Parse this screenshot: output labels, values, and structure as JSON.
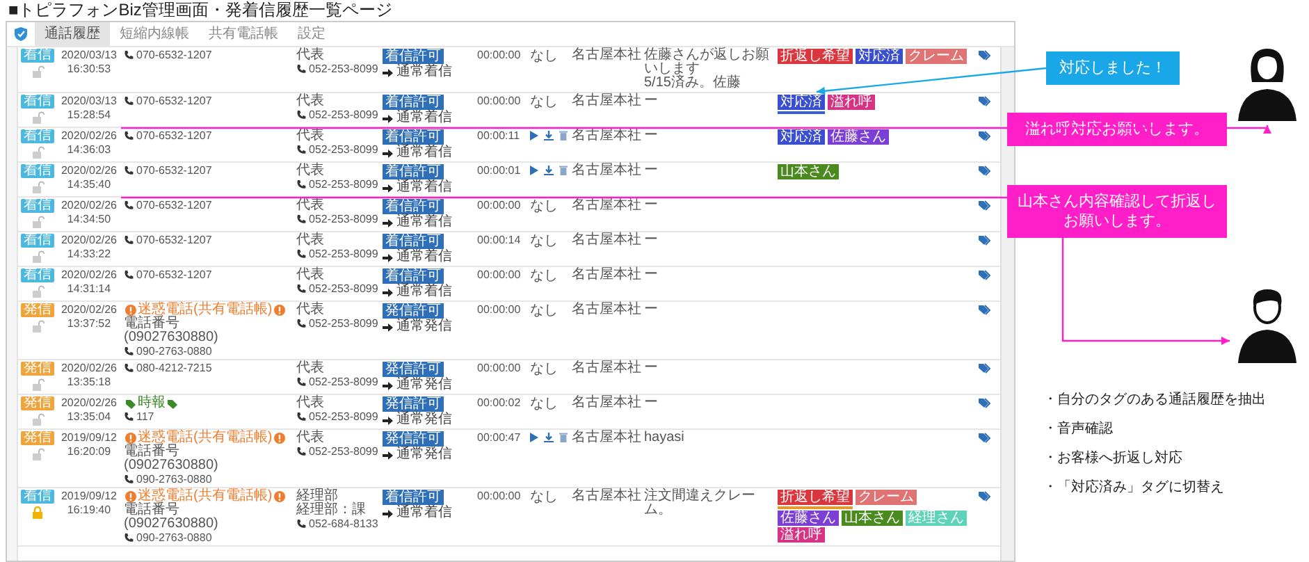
{
  "title": "■トピラフォンBiz管理画面・発着信履歴一覧ページ",
  "tabs": [
    {
      "label": "通話履歴",
      "selected": true
    },
    {
      "label": "短縮内線帳",
      "selected": false
    },
    {
      "label": "共有電話帳",
      "selected": false
    },
    {
      "label": "設定",
      "selected": false
    }
  ],
  "rows": [
    {
      "kind": "incoming",
      "badge": "着信",
      "locked": false,
      "date": "2020/03/13",
      "time": "16:30:53",
      "caller": [
        {
          "kind": "phone",
          "text": "070-6532-1207"
        }
      ],
      "callee": [
        {
          "kind": "label",
          "text": "代表"
        },
        {
          "kind": "phone",
          "text": "052-253-8099"
        }
      ],
      "permission": "着信許可",
      "route": "通常着信",
      "duration": "00:00:00",
      "recording": false,
      "action_text": "なし",
      "branch": "名古屋本社",
      "memo": [
        "佐藤さんが返しお願いします",
        "5/15済み。佐藤"
      ],
      "tags": [
        {
          "label": "折返し希望",
          "color": "#d9363e"
        },
        {
          "label": "対応済",
          "color": "#3a4fd0"
        },
        {
          "label": "クレーム",
          "color": "#e07474"
        }
      ]
    },
    {
      "kind": "incoming",
      "badge": "着信",
      "locked": false,
      "date": "2020/03/13",
      "time": "15:28:54",
      "caller": [
        {
          "kind": "phone",
          "text": "070-6532-1207"
        }
      ],
      "callee": [
        {
          "kind": "label",
          "text": "代表"
        },
        {
          "kind": "phone",
          "text": "052-253-8099"
        }
      ],
      "permission": "着信許可",
      "route": "通常着信",
      "duration": "00:00:00",
      "recording": false,
      "action_text": "なし",
      "branch": "名古屋本社",
      "memo": [
        "ー"
      ],
      "tags": [
        {
          "label": "対応済",
          "color": "#3a4fd0",
          "marker": {
            "color": "#3a5fc8"
          }
        },
        {
          "label": "溢れ呼",
          "color": "#d63384"
        }
      ]
    },
    {
      "kind": "incoming",
      "badge": "着信",
      "locked": false,
      "date": "2020/02/26",
      "time": "14:36:03",
      "caller": [
        {
          "kind": "phone",
          "text": "070-6532-1207"
        }
      ],
      "callee": [
        {
          "kind": "label",
          "text": "代表"
        },
        {
          "kind": "phone",
          "text": "052-253-8099"
        }
      ],
      "permission": "着信許可",
      "route": "通常着信",
      "duration": "00:00:11",
      "recording": true,
      "branch": "名古屋本社",
      "memo": [
        "ー"
      ],
      "tags": [
        {
          "label": "対応済",
          "color": "#3a4fd0"
        },
        {
          "label": "佐藤さん",
          "color": "#7b3fd6"
        }
      ]
    },
    {
      "kind": "incoming",
      "badge": "着信",
      "locked": false,
      "date": "2020/02/26",
      "time": "14:35:40",
      "caller": [
        {
          "kind": "phone",
          "text": "070-6532-1207"
        }
      ],
      "callee": [
        {
          "kind": "label",
          "text": "代表"
        },
        {
          "kind": "phone",
          "text": "052-253-8099"
        }
      ],
      "permission": "着信許可",
      "route": "通常着信",
      "duration": "00:00:01",
      "recording": true,
      "branch": "名古屋本社",
      "memo": [
        "ー"
      ],
      "tags": [
        {
          "label": "山本さん",
          "color": "#4a8a1f"
        }
      ]
    },
    {
      "kind": "incoming",
      "badge": "着信",
      "locked": false,
      "date": "2020/02/26",
      "time": "14:34:50",
      "caller": [
        {
          "kind": "phone",
          "text": "070-6532-1207"
        }
      ],
      "callee": [
        {
          "kind": "label",
          "text": "代表"
        },
        {
          "kind": "phone",
          "text": "052-253-8099"
        }
      ],
      "permission": "着信許可",
      "route": "通常着信",
      "duration": "00:00:00",
      "recording": false,
      "action_text": "なし",
      "branch": "名古屋本社",
      "memo": [
        "ー"
      ],
      "tags": []
    },
    {
      "kind": "incoming",
      "badge": "着信",
      "locked": false,
      "date": "2020/02/26",
      "time": "14:33:22",
      "caller": [
        {
          "kind": "phone",
          "text": "070-6532-1207"
        }
      ],
      "callee": [
        {
          "kind": "label",
          "text": "代表"
        },
        {
          "kind": "phone",
          "text": "052-253-8099"
        }
      ],
      "permission": "着信許可",
      "route": "通常着信",
      "duration": "00:00:14",
      "recording": false,
      "action_text": "なし",
      "branch": "名古屋本社",
      "memo": [
        "ー"
      ],
      "tags": []
    },
    {
      "kind": "incoming",
      "badge": "着信",
      "locked": false,
      "date": "2020/02/26",
      "time": "14:31:14",
      "caller": [
        {
          "kind": "phone",
          "text": "070-6532-1207"
        }
      ],
      "callee": [
        {
          "kind": "label",
          "text": "代表"
        },
        {
          "kind": "phone",
          "text": "052-253-8099"
        }
      ],
      "permission": "着信許可",
      "route": "通常着信",
      "duration": "00:00:00",
      "recording": false,
      "action_text": "なし",
      "branch": "名古屋本社",
      "memo": [
        "ー"
      ],
      "tags": []
    },
    {
      "kind": "outgoing",
      "badge": "発信",
      "locked": false,
      "date": "2020/02/26",
      "time": "13:37:52",
      "caller": [
        {
          "kind": "warning",
          "text": "迷惑電話(共有電話帳)"
        },
        {
          "kind": "label",
          "text": "電話番号"
        },
        {
          "kind": "label",
          "text": "(09027630880)"
        },
        {
          "kind": "phone",
          "text": "090-2763-0880"
        }
      ],
      "callee": [
        {
          "kind": "label",
          "text": "代表"
        },
        {
          "kind": "phone",
          "text": "052-253-8099"
        }
      ],
      "permission": "発信許可",
      "route": "通常発信",
      "duration": "00:00:00",
      "recording": false,
      "action_text": "なし",
      "branch": "名古屋本社",
      "memo": [
        "ー"
      ],
      "tags": []
    },
    {
      "kind": "outgoing",
      "badge": "発信",
      "locked": false,
      "date": "2020/02/26",
      "time": "13:35:18",
      "caller": [
        {
          "kind": "phone",
          "text": "080-4212-7215"
        }
      ],
      "callee": [
        {
          "kind": "label",
          "text": "代表"
        },
        {
          "kind": "phone",
          "text": "052-253-8099"
        }
      ],
      "permission": "発信許可",
      "route": "通常発信",
      "duration": "00:00:00",
      "recording": false,
      "action_text": "なし",
      "branch": "名古屋本社",
      "memo": [
        "ー"
      ],
      "tags": []
    },
    {
      "kind": "outgoing",
      "badge": "発信",
      "locked": false,
      "date": "2020/02/26",
      "time": "13:35:04",
      "caller": [
        {
          "kind": "bookmark",
          "text": "時報"
        },
        {
          "kind": "phone",
          "text": "117"
        }
      ],
      "callee": [
        {
          "kind": "label",
          "text": "代表"
        },
        {
          "kind": "phone",
          "text": "052-253-8099"
        }
      ],
      "permission": "発信許可",
      "route": "通常発信",
      "duration": "00:00:02",
      "recording": false,
      "action_text": "なし",
      "branch": "名古屋本社",
      "memo": [
        "ー"
      ],
      "tags": []
    },
    {
      "kind": "outgoing",
      "badge": "発信",
      "locked": false,
      "date": "2019/09/12",
      "time": "16:20:09",
      "caller": [
        {
          "kind": "warning",
          "text": "迷惑電話(共有電話帳)"
        },
        {
          "kind": "label",
          "text": "電話番号"
        },
        {
          "kind": "label",
          "text": "(09027630880)"
        },
        {
          "kind": "phone",
          "text": "090-2763-0880"
        }
      ],
      "callee": [
        {
          "kind": "label",
          "text": "代表"
        },
        {
          "kind": "phone",
          "text": "052-253-8099"
        }
      ],
      "permission": "発信許可",
      "route": "通常発信",
      "duration": "00:00:47",
      "recording": true,
      "branch": "名古屋本社",
      "memo": [
        "hayasi"
      ],
      "tags": []
    },
    {
      "kind": "incoming",
      "badge": "着信",
      "locked": true,
      "date": "2019/09/12",
      "time": "16:19:40",
      "caller": [
        {
          "kind": "warning",
          "text": "迷惑電話(共有電話帳)"
        },
        {
          "kind": "label",
          "text": "電話番号"
        },
        {
          "kind": "label",
          "text": "(09027630880)"
        },
        {
          "kind": "phone",
          "text": "090-2763-0880"
        }
      ],
      "callee": [
        {
          "kind": "label",
          "text": "経理部"
        },
        {
          "kind": "label",
          "text": "経理部：課"
        },
        {
          "kind": "phone",
          "text": "052-684-8133"
        }
      ],
      "permission": "着信許可",
      "route": "通常着信",
      "duration": "00:00:00",
      "recording": false,
      "action_text": "なし",
      "branch": "名古屋本社",
      "memo": [
        "注文間違えクレーム。"
      ],
      "tags": [
        {
          "label": "折返し希望",
          "color": "#d9363e",
          "marker": {
            "color": "#e69a2e"
          }
        },
        {
          "label": "クレーム",
          "color": "#e07474"
        },
        {
          "label": "佐藤さん",
          "color": "#7b3fd6"
        },
        {
          "label": "山本さん",
          "color": "#4a8a1f"
        },
        {
          "label": "経理さん",
          "color": "#5fd3b8"
        },
        {
          "label": "溢れ呼",
          "color": "#d63384"
        }
      ]
    }
  ],
  "callouts": [
    {
      "kind": "blue",
      "text": "対応しました！"
    },
    {
      "kind": "magenta",
      "text": "溢れ呼対応お願いします。"
    },
    {
      "kind": "magenta",
      "text": "山本さん内容確認して折返しお願いします。"
    }
  ],
  "people": [
    {
      "kind": "woman"
    },
    {
      "kind": "man"
    }
  ],
  "steps": [
    "・自分のタグのある通話履歴を抽出",
    "・音声確認",
    "・お客様へ折返し対応",
    "・「対応済み」タグに切替え"
  ]
}
